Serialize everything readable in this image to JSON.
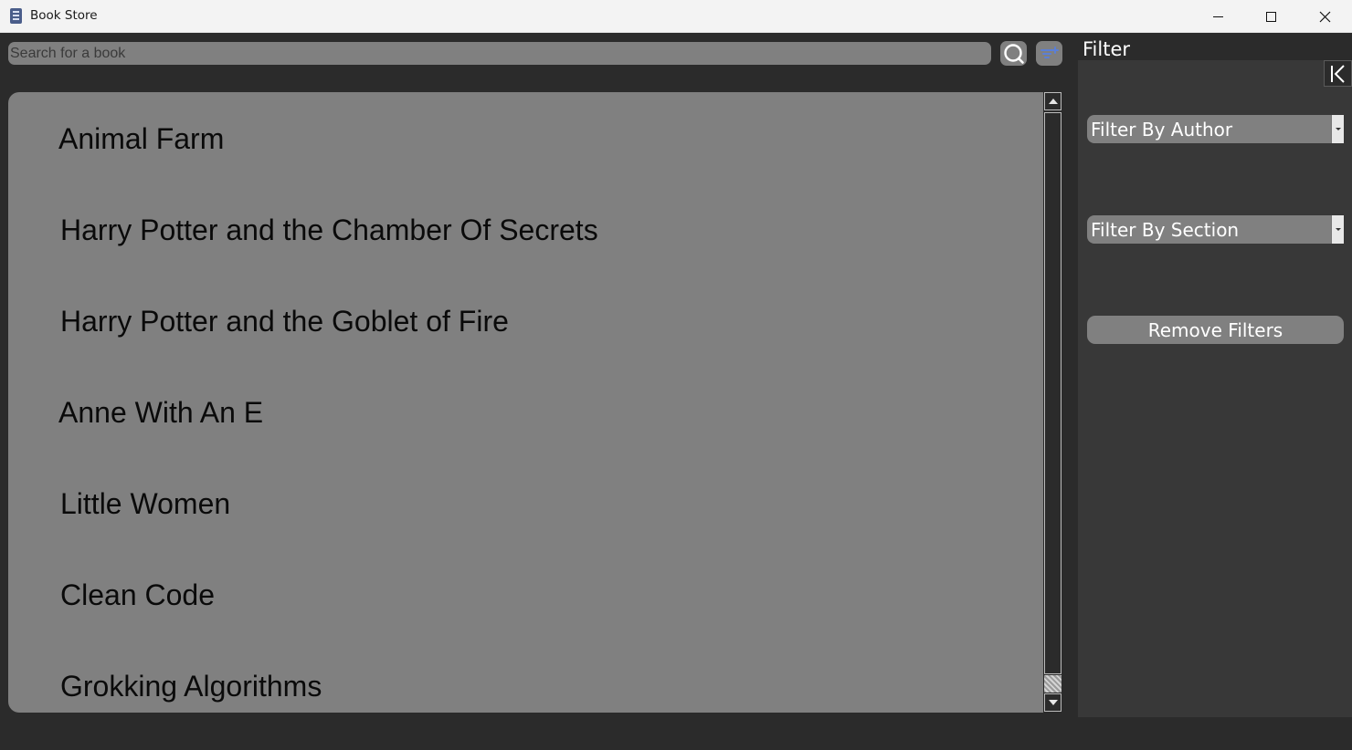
{
  "window": {
    "title": "Book Store",
    "controls": [
      "minimize",
      "maximize",
      "close"
    ]
  },
  "search": {
    "placeholder": "Search for a book",
    "value": "",
    "search_icon": "search-icon",
    "filter_icon": "filter-add-icon"
  },
  "books": [
    "Animal Farm",
    "Harry Potter and the Chamber Of Secrets",
    "Harry Potter and the Goblet of Fire",
    "Anne With An E",
    "Little Women",
    "Clean Code",
    "Grokking Algorithms"
  ],
  "filter": {
    "title": "Filter",
    "collapse_icon": "collapse-left-icon",
    "author_dropdown": "Filter By Author",
    "section_dropdown": "Filter By Section",
    "remove_button": "Remove Filters"
  },
  "colors": {
    "background": "#2b2b2b",
    "panel": "#383838",
    "widget": "#808080",
    "titlebar": "#f3f3f3"
  }
}
